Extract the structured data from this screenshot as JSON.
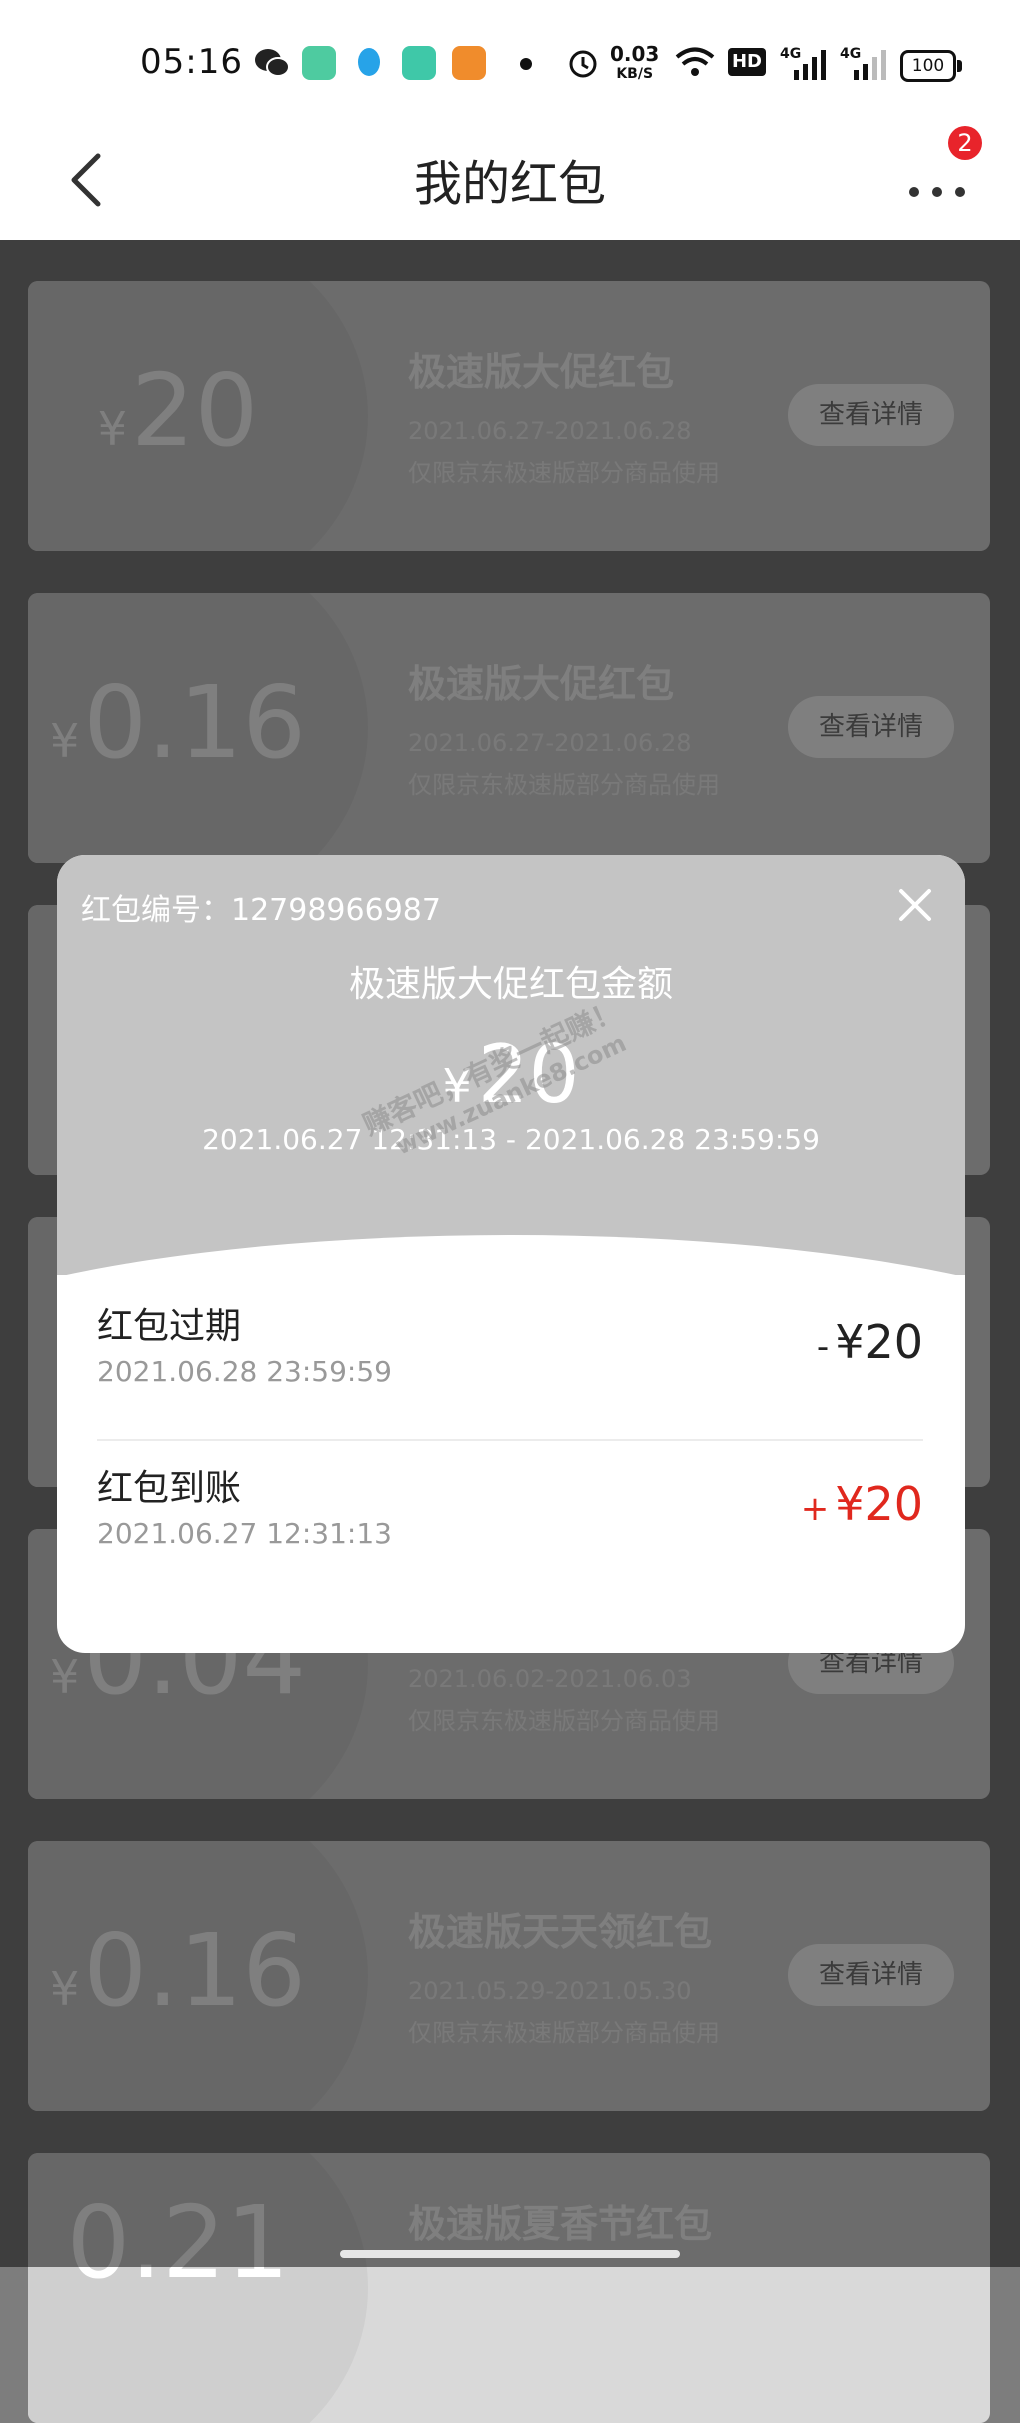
{
  "status_bar": {
    "time": "05:16",
    "net_speed_value": "0.03",
    "net_speed_unit": "KB/S",
    "hd_label": "HD",
    "signal1_label": "4G",
    "signal2_label": "4G",
    "battery": "100",
    "app_icons": [
      "wechat-icon",
      "app-green-icon",
      "qq-icon",
      "app-teal-icon",
      "uc-browser-icon"
    ]
  },
  "header": {
    "title": "我的红包",
    "badge_count": "2"
  },
  "coupons": [
    {
      "yen": "¥",
      "amount": "20",
      "name": "极速版大促红包",
      "date": "2021.06.27-2021.06.28",
      "desc": "仅限京东极速版部分商品使用",
      "button": "查看详情"
    },
    {
      "yen": "¥",
      "amount": "0.16",
      "name": "极速版大促红包",
      "date": "2021.06.27-2021.06.28",
      "desc": "仅限京东极速版部分商品使用",
      "button": "查看详情"
    },
    {
      "yen": "¥",
      "amount": "",
      "name": "",
      "date": "",
      "desc": "",
      "button": ""
    },
    {
      "yen": "¥",
      "amount": "",
      "name": "",
      "date": "",
      "desc": "",
      "button": ""
    },
    {
      "yen": "¥",
      "amount": "0.04",
      "name": "",
      "date": "2021.06.02-2021.06.03",
      "desc": "仅限京东极速版部分商品使用",
      "button": "查看详情"
    },
    {
      "yen": "¥",
      "amount": "0.16",
      "name": "极速版天天领红包",
      "date": "2021.05.29-2021.05.30",
      "desc": "仅限京东极速版部分商品使用",
      "button": "查看详情"
    },
    {
      "yen": "",
      "amount": "0.21",
      "name": "极速版夏香节红包",
      "date": "",
      "desc": "",
      "button": ""
    }
  ],
  "modal": {
    "serial": "红包编号：12798966987",
    "title": "极速版大促红包金额",
    "yen": "¥",
    "amount": "20",
    "range": "2021.06.27 12:31:13 - 2021.06.28 23:59:59",
    "watermark_line1": "赚客吧，有奖一起赚！",
    "watermark_line2": "www.zuanke8.com",
    "records": [
      {
        "title": "红包过期",
        "time": "2021.06.28 23:59:59",
        "sign": "-",
        "amount": "¥20"
      },
      {
        "title": "红包到账",
        "time": "2021.06.27 12:31:13",
        "sign": "+",
        "amount": "¥20"
      }
    ]
  },
  "colors": {
    "accent_red": "#e0281e",
    "badge_red": "#e8242b"
  }
}
